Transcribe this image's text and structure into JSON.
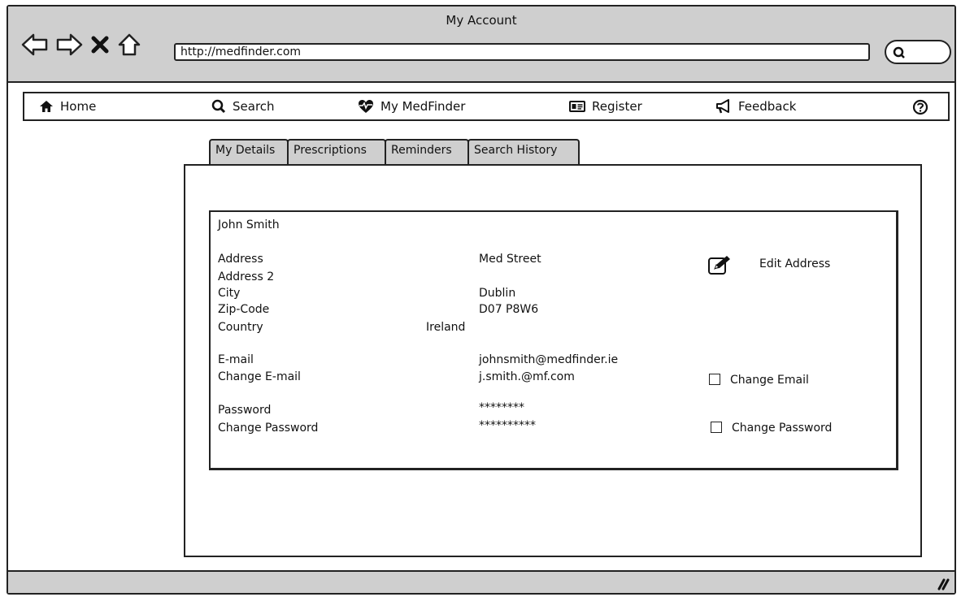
{
  "window": {
    "title": "My Account"
  },
  "browser": {
    "url": "http://medfinder.com"
  },
  "menu": {
    "home": "Home",
    "search": "Search",
    "mymedfinder": "My MedFinder",
    "register": "Register",
    "feedback": "Feedback"
  },
  "tabs": [
    "My Details",
    "Prescriptions",
    "Reminders",
    "Search History"
  ],
  "details": {
    "name": "John Smith",
    "labels": {
      "address": "Address",
      "address2": "Address 2",
      "city": "City",
      "zip": "Zip-Code",
      "country": "Country",
      "email": "E-mail",
      "change_email": "Change E-mail",
      "password": "Password",
      "change_password": "Change Password"
    },
    "values": {
      "address": "Med Street",
      "city": "Dublin",
      "zip": "D07 P8W6",
      "country": "Ireland",
      "email": "johnsmith@medfinder.ie",
      "change_email": "j.smith.@mf.com",
      "password": "********",
      "change_password": "**********"
    },
    "actions": {
      "edit_address": "Edit Address",
      "change_email": "Change Email",
      "change_password": "Change Password"
    }
  }
}
